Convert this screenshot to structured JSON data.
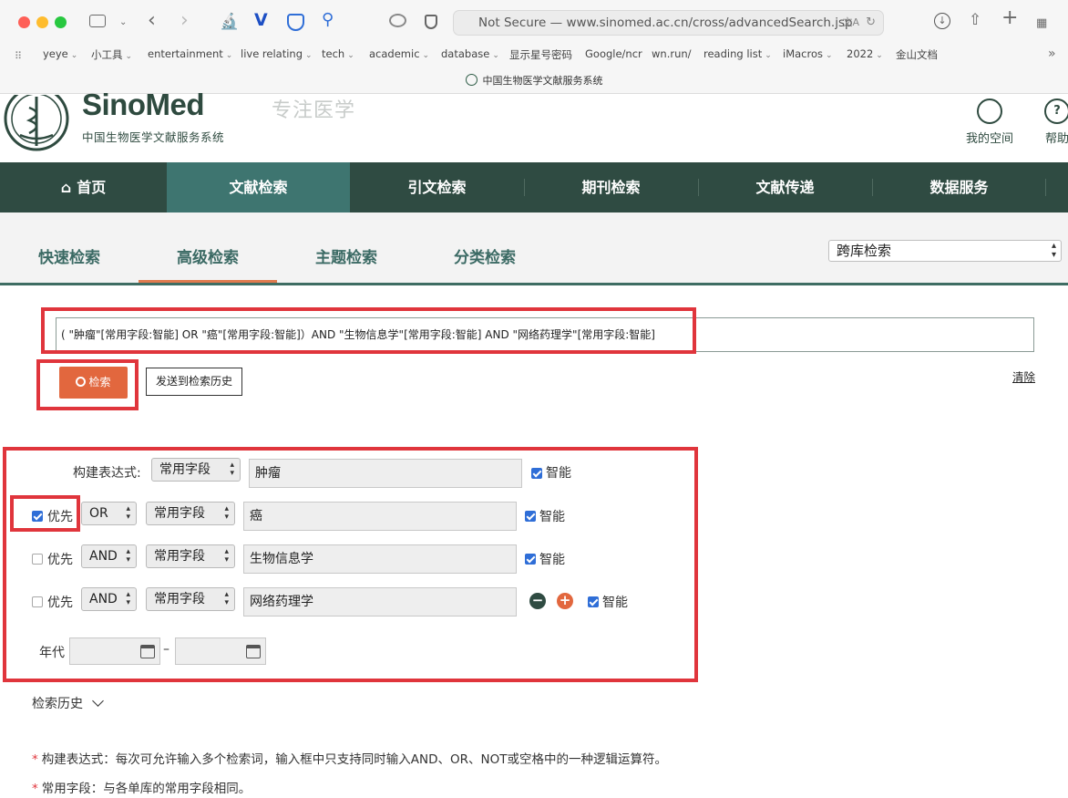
{
  "browser": {
    "url_text": "Not Secure — www.sinomed.ac.cn/cross/advancedSearch.jsp",
    "tab_title": "中国生物医学文献服务系统",
    "bookmarks": [
      {
        "label": "yeye",
        "menu": true
      },
      {
        "label": "小工具",
        "menu": true
      },
      {
        "label": "entertainment",
        "menu": true
      },
      {
        "label": "live relating",
        "menu": true
      },
      {
        "label": "tech",
        "menu": true
      },
      {
        "label": "academic",
        "menu": true
      },
      {
        "label": "database",
        "menu": true
      },
      {
        "label": "显示星号密码",
        "menu": false
      },
      {
        "label": "Google/ncr",
        "menu": false
      },
      {
        "label": "wn.run/",
        "menu": false
      },
      {
        "label": "reading list",
        "menu": true
      },
      {
        "label": "iMacros",
        "menu": true
      },
      {
        "label": "2022",
        "menu": true
      },
      {
        "label": "金山文档",
        "menu": false
      }
    ]
  },
  "site": {
    "logo_name": "SinoMed",
    "logo_subtitle": "中国生物医学文献服务系统",
    "slogan": "专注医学",
    "my_space": "我的空间",
    "help": "帮助"
  },
  "nav": [
    "首页",
    "文献检索",
    "引文检索",
    "期刊检索",
    "文献传递",
    "数据服务"
  ],
  "subtabs": [
    "快速检索",
    "高级检索",
    "主题检索",
    "分类检索"
  ],
  "db_select": "跨库检索",
  "search": {
    "query": "( \"肿瘤\"[常用字段:智能] OR \"癌\"[常用字段:智能]）AND \"生物信息学\"[常用字段:智能] AND \"网络药理学\"[常用字段:智能]",
    "search_label": "检索",
    "send_history_label": "发送到检索历史",
    "clear_label": "清除"
  },
  "builder": {
    "label": "构建表达式:",
    "priority_label": "优先",
    "smart_label": "智能",
    "year_label": "年代",
    "rows": [
      {
        "op": "",
        "field": "常用字段",
        "term": "肿瘤",
        "priority": null,
        "smart": true
      },
      {
        "op": "OR",
        "field": "常用字段",
        "term": "癌",
        "priority": true,
        "smart": true
      },
      {
        "op": "AND",
        "field": "常用字段",
        "term": "生物信息学",
        "priority": false,
        "smart": true
      },
      {
        "op": "AND",
        "field": "常用字段",
        "term": "网络药理学",
        "priority": false,
        "smart": true
      }
    ]
  },
  "history_label": "检索历史",
  "notes": [
    "构建表达式：每次可允许输入多个检索词，输入框中只支持同时输入AND、OR、NOT或空格中的一种逻辑运算符。",
    "常用字段：与各单库的常用字段相同。"
  ],
  "colors": {
    "nav_bg": "#2f4b42",
    "nav_active": "#3e7570",
    "accent": "#e2673e",
    "highlight": "#e0353c"
  }
}
